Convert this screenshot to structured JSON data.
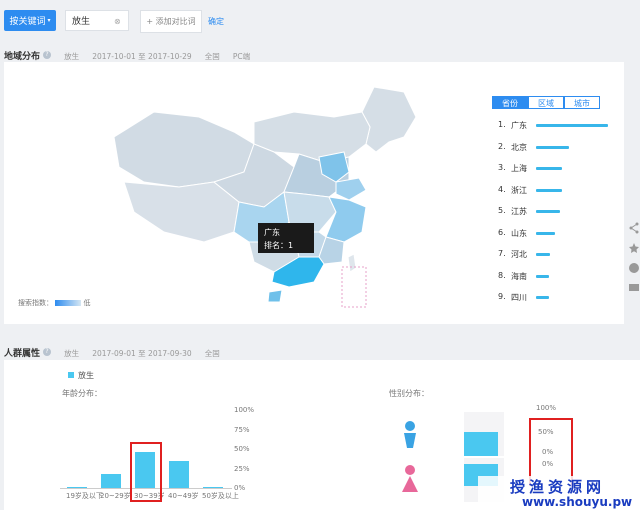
{
  "toolbar": {
    "keyword_button": "按关键词",
    "keyword_chip": "放生",
    "add_compare": "+ 添加对比词",
    "confirm": "确定"
  },
  "region": {
    "title": "地域分布",
    "keyword": "放生",
    "date_range": "2017-10-01 至 2017-10-29",
    "scope": "全国",
    "device": "PC端",
    "tabs": [
      "省份",
      "区域",
      "城市"
    ],
    "active_tab": "省份",
    "legend_label": "搜索指数：",
    "legend_low": "低",
    "tooltip_name": "广东",
    "tooltip_rank": "排名：1",
    "rankings": [
      {
        "num": "1.",
        "name": "广东",
        "value": 100
      },
      {
        "num": "2.",
        "name": "北京",
        "value": 46
      },
      {
        "num": "3.",
        "name": "上海",
        "value": 36
      },
      {
        "num": "4.",
        "name": "浙江",
        "value": 36
      },
      {
        "num": "5.",
        "name": "江苏",
        "value": 34
      },
      {
        "num": "6.",
        "name": "山东",
        "value": 26
      },
      {
        "num": "7.",
        "name": "河北",
        "value": 20
      },
      {
        "num": "8.",
        "name": "海南",
        "value": 18
      },
      {
        "num": "9.",
        "name": "四川",
        "value": 18
      }
    ]
  },
  "crowd": {
    "title": "人群属性",
    "keyword": "放生",
    "date_range": "2017-09-01 至 2017-09-30",
    "scope": "全国",
    "legend": "放生",
    "age_title": "年龄分布：",
    "gender_title": "性别分布：",
    "age_yticks": [
      "100%",
      "75%",
      "50%",
      "25%",
      "0%"
    ],
    "age_categories": [
      "19岁及以下",
      "20~29岁",
      "30~39岁",
      "40~49岁",
      "50岁及以上"
    ],
    "age_values": [
      1,
      18,
      46,
      34,
      1
    ],
    "gender_yticks": [
      "100%",
      "50%",
      "0%",
      "0%"
    ]
  },
  "colors": {
    "accent": "#2d8cf0",
    "bar": "#4ac8f0",
    "highlight_box": "#e02020",
    "male": "#3aa3e3",
    "female": "#e8689a"
  },
  "watermark": {
    "line1": "授渔资源网",
    "line2": "www.shouyu.pw"
  }
}
